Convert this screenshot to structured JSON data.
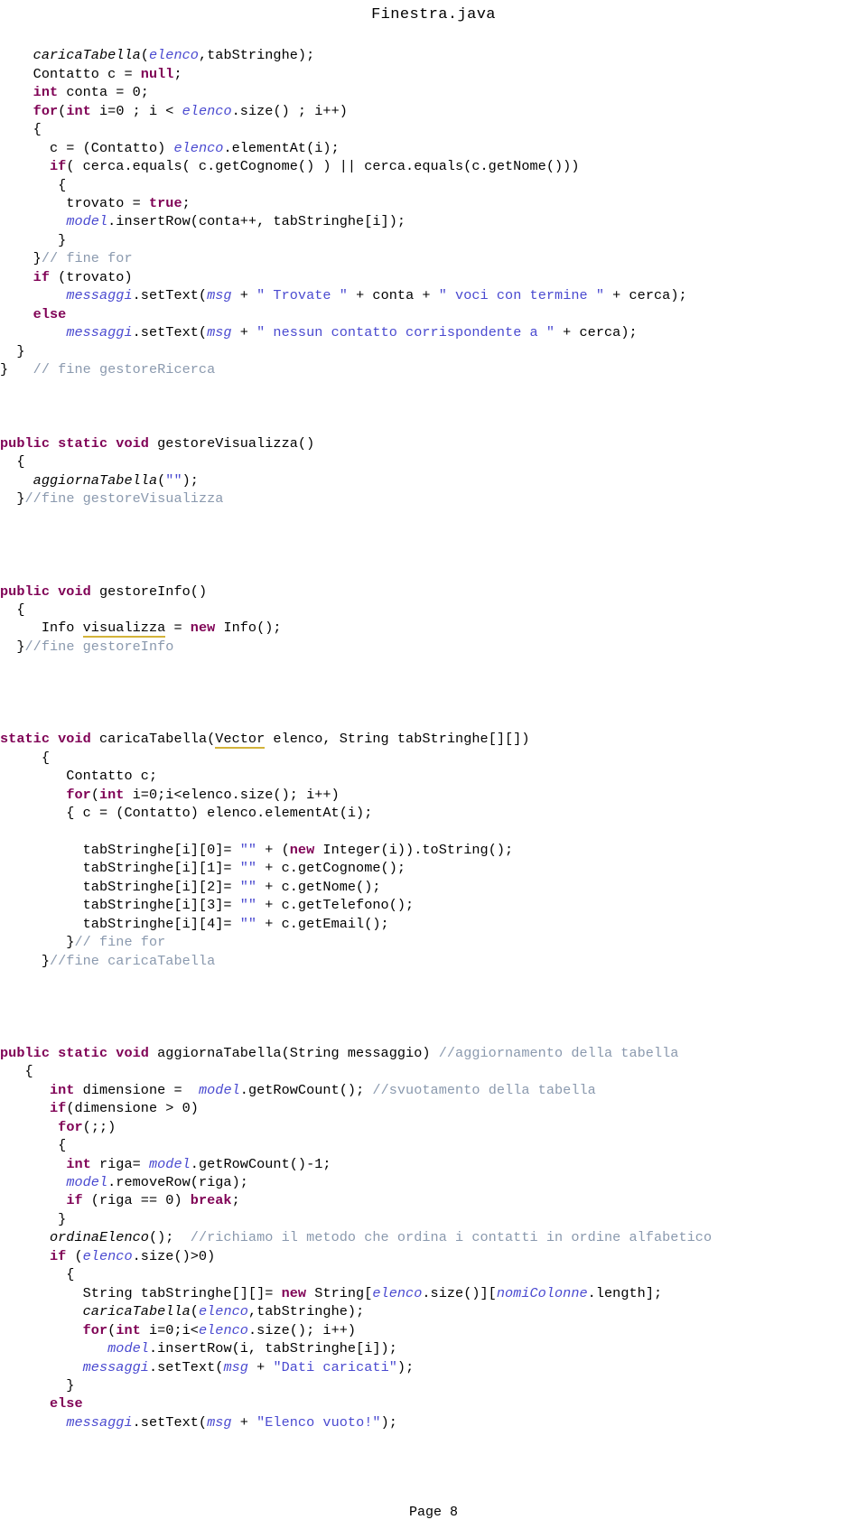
{
  "document": {
    "title": "Finestra.java",
    "footer": "Page 8",
    "language": "java"
  },
  "colors": {
    "background": "#ffffff",
    "text": "#000000",
    "keyword": "#7f0055",
    "comment": "#8a99ae",
    "string": "#4a4ad0",
    "field": "#4a4ad0",
    "warning_underline": "#d3b33a"
  },
  "code": {
    "lines": [
      [
        {
          "t": "plain",
          "v": "    "
        },
        {
          "t": "static",
          "v": "caricaTabella"
        },
        {
          "t": "plain",
          "v": "("
        },
        {
          "t": "field",
          "v": "elenco"
        },
        {
          "t": "plain",
          "v": ",tabStringhe);"
        }
      ],
      [
        {
          "t": "plain",
          "v": "    Contatto c = "
        },
        {
          "t": "kw",
          "v": "null"
        },
        {
          "t": "plain",
          "v": ";"
        }
      ],
      [
        {
          "t": "plain",
          "v": "    "
        },
        {
          "t": "kw",
          "v": "int"
        },
        {
          "t": "plain",
          "v": " conta = 0;"
        }
      ],
      [
        {
          "t": "plain",
          "v": "    "
        },
        {
          "t": "kw",
          "v": "for"
        },
        {
          "t": "plain",
          "v": "("
        },
        {
          "t": "kw",
          "v": "int"
        },
        {
          "t": "plain",
          "v": " i=0 ; i < "
        },
        {
          "t": "field",
          "v": "elenco"
        },
        {
          "t": "plain",
          "v": ".size() ; i++)"
        }
      ],
      [
        {
          "t": "plain",
          "v": "    {"
        }
      ],
      [
        {
          "t": "plain",
          "v": "      c = (Contatto) "
        },
        {
          "t": "field",
          "v": "elenco"
        },
        {
          "t": "plain",
          "v": ".elementAt(i);"
        }
      ],
      [
        {
          "t": "plain",
          "v": "      "
        },
        {
          "t": "kw",
          "v": "if"
        },
        {
          "t": "plain",
          "v": "( cerca.equals( c.getCognome() ) || cerca.equals(c.getNome()))"
        }
      ],
      [
        {
          "t": "plain",
          "v": "       {"
        }
      ],
      [
        {
          "t": "plain",
          "v": "        trovato = "
        },
        {
          "t": "kw",
          "v": "true"
        },
        {
          "t": "plain",
          "v": ";"
        }
      ],
      [
        {
          "t": "plain",
          "v": "        "
        },
        {
          "t": "field",
          "v": "model"
        },
        {
          "t": "plain",
          "v": ".insertRow(conta++, tabStringhe[i]);"
        }
      ],
      [
        {
          "t": "plain",
          "v": "       }"
        }
      ],
      [
        {
          "t": "plain",
          "v": "    }"
        },
        {
          "t": "cmt",
          "v": "// fine for"
        }
      ],
      [
        {
          "t": "plain",
          "v": "    "
        },
        {
          "t": "kw",
          "v": "if"
        },
        {
          "t": "plain",
          "v": " (trovato)"
        }
      ],
      [
        {
          "t": "plain",
          "v": "        "
        },
        {
          "t": "field",
          "v": "messaggi"
        },
        {
          "t": "plain",
          "v": ".setText("
        },
        {
          "t": "field",
          "v": "msg"
        },
        {
          "t": "plain",
          "v": " + "
        },
        {
          "t": "str",
          "v": "\" Trovate \""
        },
        {
          "t": "plain",
          "v": " + conta + "
        },
        {
          "t": "str",
          "v": "\" voci con termine \""
        },
        {
          "t": "plain",
          "v": " + cerca);"
        }
      ],
      [
        {
          "t": "plain",
          "v": "    "
        },
        {
          "t": "kw",
          "v": "else"
        }
      ],
      [
        {
          "t": "plain",
          "v": "        "
        },
        {
          "t": "field",
          "v": "messaggi"
        },
        {
          "t": "plain",
          "v": ".setText("
        },
        {
          "t": "field",
          "v": "msg"
        },
        {
          "t": "plain",
          "v": " + "
        },
        {
          "t": "str",
          "v": "\" nessun contatto corrispondente a \""
        },
        {
          "t": "plain",
          "v": " + cerca);"
        }
      ],
      [
        {
          "t": "plain",
          "v": "  }"
        }
      ],
      [
        {
          "t": "plain",
          "v": "}   "
        },
        {
          "t": "cmt",
          "v": "// fine gestoreRicerca"
        }
      ],
      [],
      [],
      [],
      [
        {
          "t": "kw",
          "v": "public static void"
        },
        {
          "t": "plain",
          "v": " gestoreVisualizza()"
        }
      ],
      [
        {
          "t": "plain",
          "v": "  {"
        }
      ],
      [
        {
          "t": "plain",
          "v": "    "
        },
        {
          "t": "static",
          "v": "aggiornaTabella"
        },
        {
          "t": "plain",
          "v": "("
        },
        {
          "t": "str",
          "v": "\"\""
        },
        {
          "t": "plain",
          "v": ");"
        }
      ],
      [
        {
          "t": "plain",
          "v": "  }"
        },
        {
          "t": "cmt",
          "v": "//fine gestoreVisualizza"
        }
      ],
      [],
      [],
      [],
      [],
      [
        {
          "t": "kw",
          "v": "public void"
        },
        {
          "t": "plain",
          "v": " gestoreInfo()"
        }
      ],
      [
        {
          "t": "plain",
          "v": "  {"
        }
      ],
      [
        {
          "t": "plain",
          "v": "     Info "
        },
        {
          "t": "warn",
          "v": "visualizza"
        },
        {
          "t": "plain",
          "v": " = "
        },
        {
          "t": "kw",
          "v": "new"
        },
        {
          "t": "plain",
          "v": " Info();"
        }
      ],
      [
        {
          "t": "plain",
          "v": "  }"
        },
        {
          "t": "cmt",
          "v": "//fine gestoreInfo"
        }
      ],
      [],
      [],
      [],
      [],
      [
        {
          "t": "kw",
          "v": "static void"
        },
        {
          "t": "plain",
          "v": " caricaTabella("
        },
        {
          "t": "warn",
          "v": "Vector"
        },
        {
          "t": "plain",
          "v": " elenco, String tabStringhe[][])"
        }
      ],
      [
        {
          "t": "plain",
          "v": "     {"
        }
      ],
      [
        {
          "t": "plain",
          "v": "        Contatto c;"
        }
      ],
      [
        {
          "t": "plain",
          "v": "        "
        },
        {
          "t": "kw",
          "v": "for"
        },
        {
          "t": "plain",
          "v": "("
        },
        {
          "t": "kw",
          "v": "int"
        },
        {
          "t": "plain",
          "v": " i=0;i<elenco.size(); i++)"
        }
      ],
      [
        {
          "t": "plain",
          "v": "        { c = (Contatto) elenco.elementAt(i);"
        }
      ],
      [],
      [
        {
          "t": "plain",
          "v": "          tabStringhe[i][0]= "
        },
        {
          "t": "str",
          "v": "\"\""
        },
        {
          "t": "plain",
          "v": " + ("
        },
        {
          "t": "kw",
          "v": "new"
        },
        {
          "t": "plain",
          "v": " Integer(i)).toString();"
        }
      ],
      [
        {
          "t": "plain",
          "v": "          tabStringhe[i][1]= "
        },
        {
          "t": "str",
          "v": "\"\""
        },
        {
          "t": "plain",
          "v": " + c.getCognome();"
        }
      ],
      [
        {
          "t": "plain",
          "v": "          tabStringhe[i][2]= "
        },
        {
          "t": "str",
          "v": "\"\""
        },
        {
          "t": "plain",
          "v": " + c.getNome();"
        }
      ],
      [
        {
          "t": "plain",
          "v": "          tabStringhe[i][3]= "
        },
        {
          "t": "str",
          "v": "\"\""
        },
        {
          "t": "plain",
          "v": " + c.getTelefono();"
        }
      ],
      [
        {
          "t": "plain",
          "v": "          tabStringhe[i][4]= "
        },
        {
          "t": "str",
          "v": "\"\""
        },
        {
          "t": "plain",
          "v": " + c.getEmail();"
        }
      ],
      [
        {
          "t": "plain",
          "v": "        }"
        },
        {
          "t": "cmt",
          "v": "// fine for"
        }
      ],
      [
        {
          "t": "plain",
          "v": "     }"
        },
        {
          "t": "cmt",
          "v": "//fine caricaTabella"
        }
      ],
      [],
      [],
      [],
      [],
      [
        {
          "t": "kw",
          "v": "public static void"
        },
        {
          "t": "plain",
          "v": " aggiornaTabella(String messaggio) "
        },
        {
          "t": "cmt",
          "v": "//aggiornamento della tabella"
        }
      ],
      [
        {
          "t": "plain",
          "v": "   {"
        }
      ],
      [
        {
          "t": "plain",
          "v": "      "
        },
        {
          "t": "kw",
          "v": "int"
        },
        {
          "t": "plain",
          "v": " dimensione =  "
        },
        {
          "t": "field",
          "v": "model"
        },
        {
          "t": "plain",
          "v": ".getRowCount(); "
        },
        {
          "t": "cmt",
          "v": "//svuotamento della tabella"
        }
      ],
      [
        {
          "t": "plain",
          "v": "      "
        },
        {
          "t": "kw",
          "v": "if"
        },
        {
          "t": "plain",
          "v": "(dimensione > 0)"
        }
      ],
      [
        {
          "t": "plain",
          "v": "       "
        },
        {
          "t": "kw",
          "v": "for"
        },
        {
          "t": "plain",
          "v": "(;;)"
        }
      ],
      [
        {
          "t": "plain",
          "v": "       {"
        }
      ],
      [
        {
          "t": "plain",
          "v": "        "
        },
        {
          "t": "kw",
          "v": "int"
        },
        {
          "t": "plain",
          "v": " riga= "
        },
        {
          "t": "field",
          "v": "model"
        },
        {
          "t": "plain",
          "v": ".getRowCount()-1;"
        }
      ],
      [
        {
          "t": "plain",
          "v": "        "
        },
        {
          "t": "field",
          "v": "model"
        },
        {
          "t": "plain",
          "v": ".removeRow(riga);"
        }
      ],
      [
        {
          "t": "plain",
          "v": "        "
        },
        {
          "t": "kw",
          "v": "if"
        },
        {
          "t": "plain",
          "v": " (riga == 0) "
        },
        {
          "t": "kw",
          "v": "break"
        },
        {
          "t": "plain",
          "v": ";"
        }
      ],
      [
        {
          "t": "plain",
          "v": "       }"
        }
      ],
      [
        {
          "t": "plain",
          "v": "      "
        },
        {
          "t": "static",
          "v": "ordinaElenco"
        },
        {
          "t": "plain",
          "v": "();  "
        },
        {
          "t": "cmt",
          "v": "//richiamo il metodo che ordina i contatti in ordine alfabetico"
        }
      ],
      [
        {
          "t": "plain",
          "v": "      "
        },
        {
          "t": "kw",
          "v": "if"
        },
        {
          "t": "plain",
          "v": " ("
        },
        {
          "t": "field",
          "v": "elenco"
        },
        {
          "t": "plain",
          "v": ".size()>0)"
        }
      ],
      [
        {
          "t": "plain",
          "v": "        {"
        }
      ],
      [
        {
          "t": "plain",
          "v": "          String tabStringhe[][]= "
        },
        {
          "t": "kw",
          "v": "new"
        },
        {
          "t": "plain",
          "v": " String["
        },
        {
          "t": "field",
          "v": "elenco"
        },
        {
          "t": "plain",
          "v": ".size()]["
        },
        {
          "t": "field",
          "v": "nomiColonne"
        },
        {
          "t": "plain",
          "v": ".length];"
        }
      ],
      [
        {
          "t": "plain",
          "v": "          "
        },
        {
          "t": "static",
          "v": "caricaTabella"
        },
        {
          "t": "plain",
          "v": "("
        },
        {
          "t": "field",
          "v": "elenco"
        },
        {
          "t": "plain",
          "v": ",tabStringhe);"
        }
      ],
      [
        {
          "t": "plain",
          "v": "          "
        },
        {
          "t": "kw",
          "v": "for"
        },
        {
          "t": "plain",
          "v": "("
        },
        {
          "t": "kw",
          "v": "int"
        },
        {
          "t": "plain",
          "v": " i=0;i<"
        },
        {
          "t": "field",
          "v": "elenco"
        },
        {
          "t": "plain",
          "v": ".size(); i++)"
        }
      ],
      [
        {
          "t": "plain",
          "v": "             "
        },
        {
          "t": "field",
          "v": "model"
        },
        {
          "t": "plain",
          "v": ".insertRow(i, tabStringhe[i]);"
        }
      ],
      [
        {
          "t": "plain",
          "v": "          "
        },
        {
          "t": "field",
          "v": "messaggi"
        },
        {
          "t": "plain",
          "v": ".setText("
        },
        {
          "t": "field",
          "v": "msg"
        },
        {
          "t": "plain",
          "v": " + "
        },
        {
          "t": "str",
          "v": "\"Dati caricati\""
        },
        {
          "t": "plain",
          "v": ");"
        }
      ],
      [
        {
          "t": "plain",
          "v": "        }"
        }
      ],
      [
        {
          "t": "plain",
          "v": "      "
        },
        {
          "t": "kw",
          "v": "else"
        }
      ],
      [
        {
          "t": "plain",
          "v": "        "
        },
        {
          "t": "field",
          "v": "messaggi"
        },
        {
          "t": "plain",
          "v": ".setText("
        },
        {
          "t": "field",
          "v": "msg"
        },
        {
          "t": "plain",
          "v": " + "
        },
        {
          "t": "str",
          "v": "\"Elenco vuoto!\""
        },
        {
          "t": "plain",
          "v": ");"
        }
      ]
    ]
  }
}
